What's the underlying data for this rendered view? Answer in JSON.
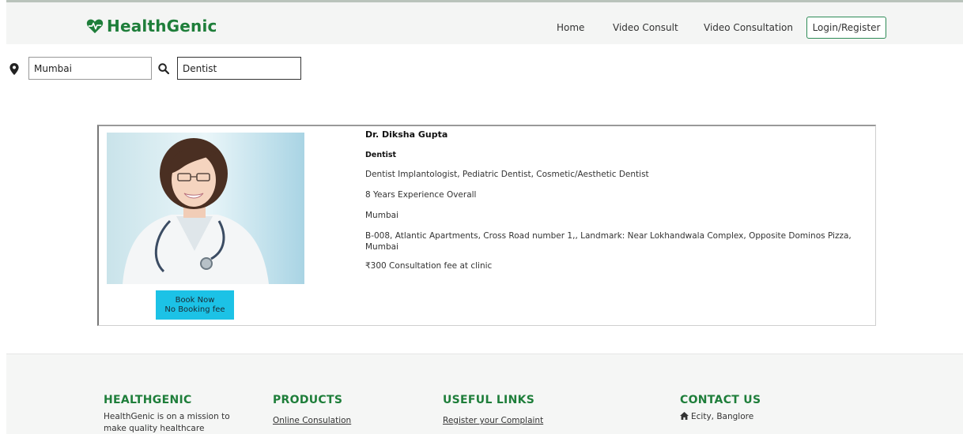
{
  "header": {
    "brand": "HealthGenic",
    "nav": [
      "Home",
      "Video Consult",
      "Video Consultation"
    ],
    "login_label": "Login/Register",
    "brand_color": "#1e7e3a"
  },
  "search": {
    "location_value": "Mumbai",
    "specialty_value": "Dentist"
  },
  "doctor": {
    "name": "Dr. Diksha Gupta",
    "specialty": "Dentist",
    "specializations": "Dentist Implantologist, Pediatric Dentist, Cosmetic/Aesthetic Dentist",
    "experience": "8 Years Experience Overall",
    "city": "Mumbai",
    "address": "B-008, Atlantic Apartments, Cross Road number 1,, Landmark: Near Lokhandwala Complex, Opposite Dominos Pizza, Mumbai",
    "fee": "₹300 Consultation fee at clinic",
    "book_label": "Book Now",
    "book_sublabel": "No Booking fee",
    "book_color": "#1cc2e6"
  },
  "footer": {
    "col1": {
      "title": "HEALTHGENIC",
      "text": "HealthGenic is on a mission to make quality healthcare"
    },
    "col2": {
      "title": "PRODUCTS",
      "link": "Online Consulation"
    },
    "col3": {
      "title": "USEFUL LINKS",
      "link": "Register your Complaint"
    },
    "col4": {
      "title": "CONTACT US",
      "text": "Ecity, Banglore"
    }
  },
  "icons": [
    "heart-pulse-icon",
    "map-pin-icon",
    "search-icon",
    "home-icon"
  ]
}
